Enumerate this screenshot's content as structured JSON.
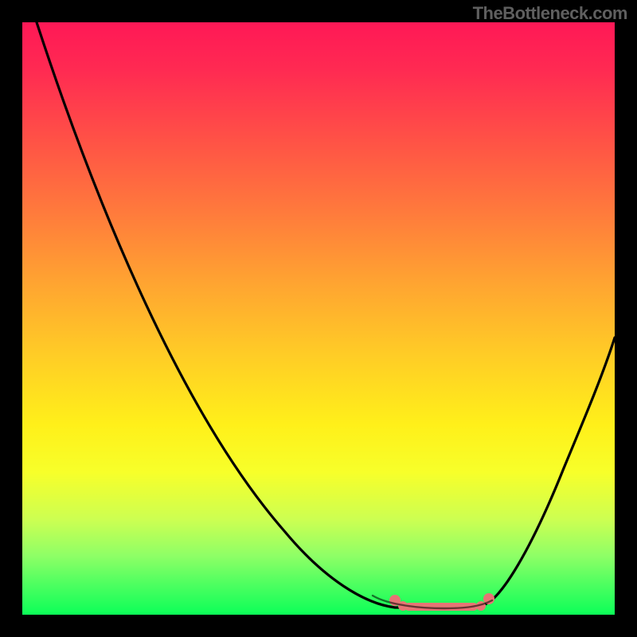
{
  "watermark": "TheBottleneck.com",
  "colors": {
    "page_bg": "#000000",
    "curve": "#000000",
    "marker": "#e77474",
    "gradient_top": "#ff1856",
    "gradient_bottom": "#0cff58",
    "watermark": "#5f5f5f"
  },
  "chart_data": {
    "type": "line",
    "title": "",
    "xlabel": "",
    "ylabel": "",
    "xlim": [
      0,
      100
    ],
    "ylim": [
      0,
      100
    ],
    "series": [
      {
        "name": "bottleneck-curve",
        "x": [
          2,
          10,
          20,
          30,
          40,
          50,
          60,
          63,
          67,
          72,
          77,
          80,
          85,
          90,
          95,
          100
        ],
        "values": [
          100,
          82,
          62,
          44,
          28,
          16,
          8,
          2,
          1,
          1,
          1,
          3,
          12,
          28,
          40,
          47
        ]
      }
    ],
    "annotations": [
      {
        "name": "optimal-range",
        "x_start": 63,
        "x_end": 79,
        "style": "pink-dots"
      }
    ],
    "background": "vertical-gradient red→orange→yellow→green (top=high bottleneck, bottom=low)",
    "grid": false,
    "legend": false
  }
}
